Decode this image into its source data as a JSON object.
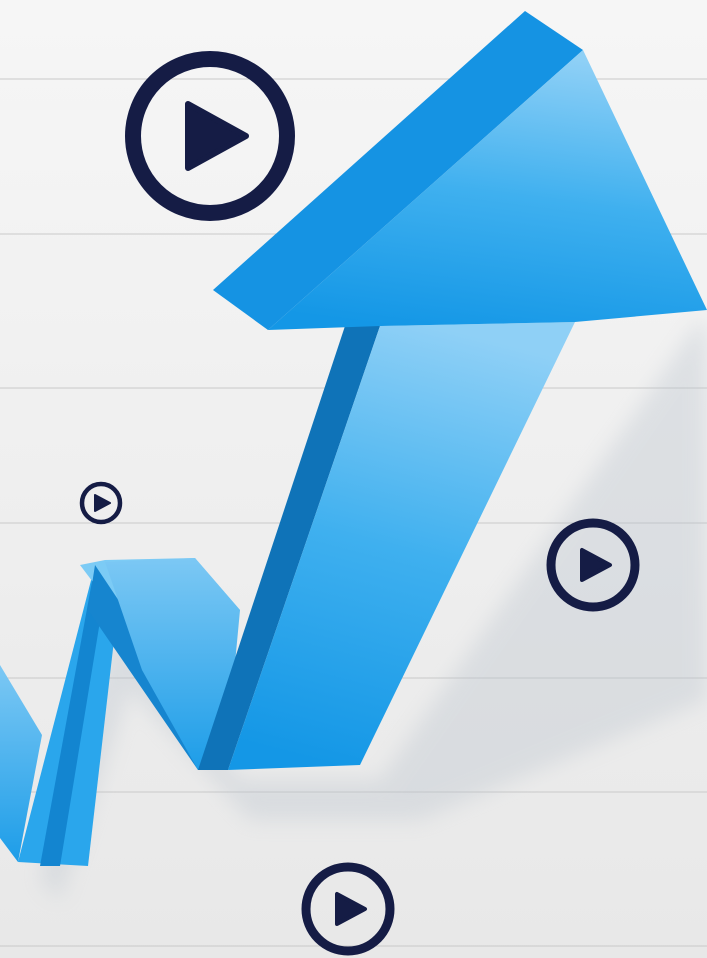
{
  "colors": {
    "background_top": "#f6f6f6",
    "background_bottom": "#e8e8e8",
    "grid_line": "#c9c9c9",
    "arrow_light": "#8fd0f6",
    "arrow_mid": "#3fb0ef",
    "arrow_deep": "#1497e6",
    "arrow_shadow_face": "#0d7fc8",
    "arrow_dark_side": "#0f73b8",
    "play_icon": "#151c45"
  },
  "icons": {
    "play_large": "play-circle-icon",
    "play_small": "play-circle-icon",
    "play_right": "play-circle-icon",
    "play_bottom": "play-circle-icon"
  }
}
